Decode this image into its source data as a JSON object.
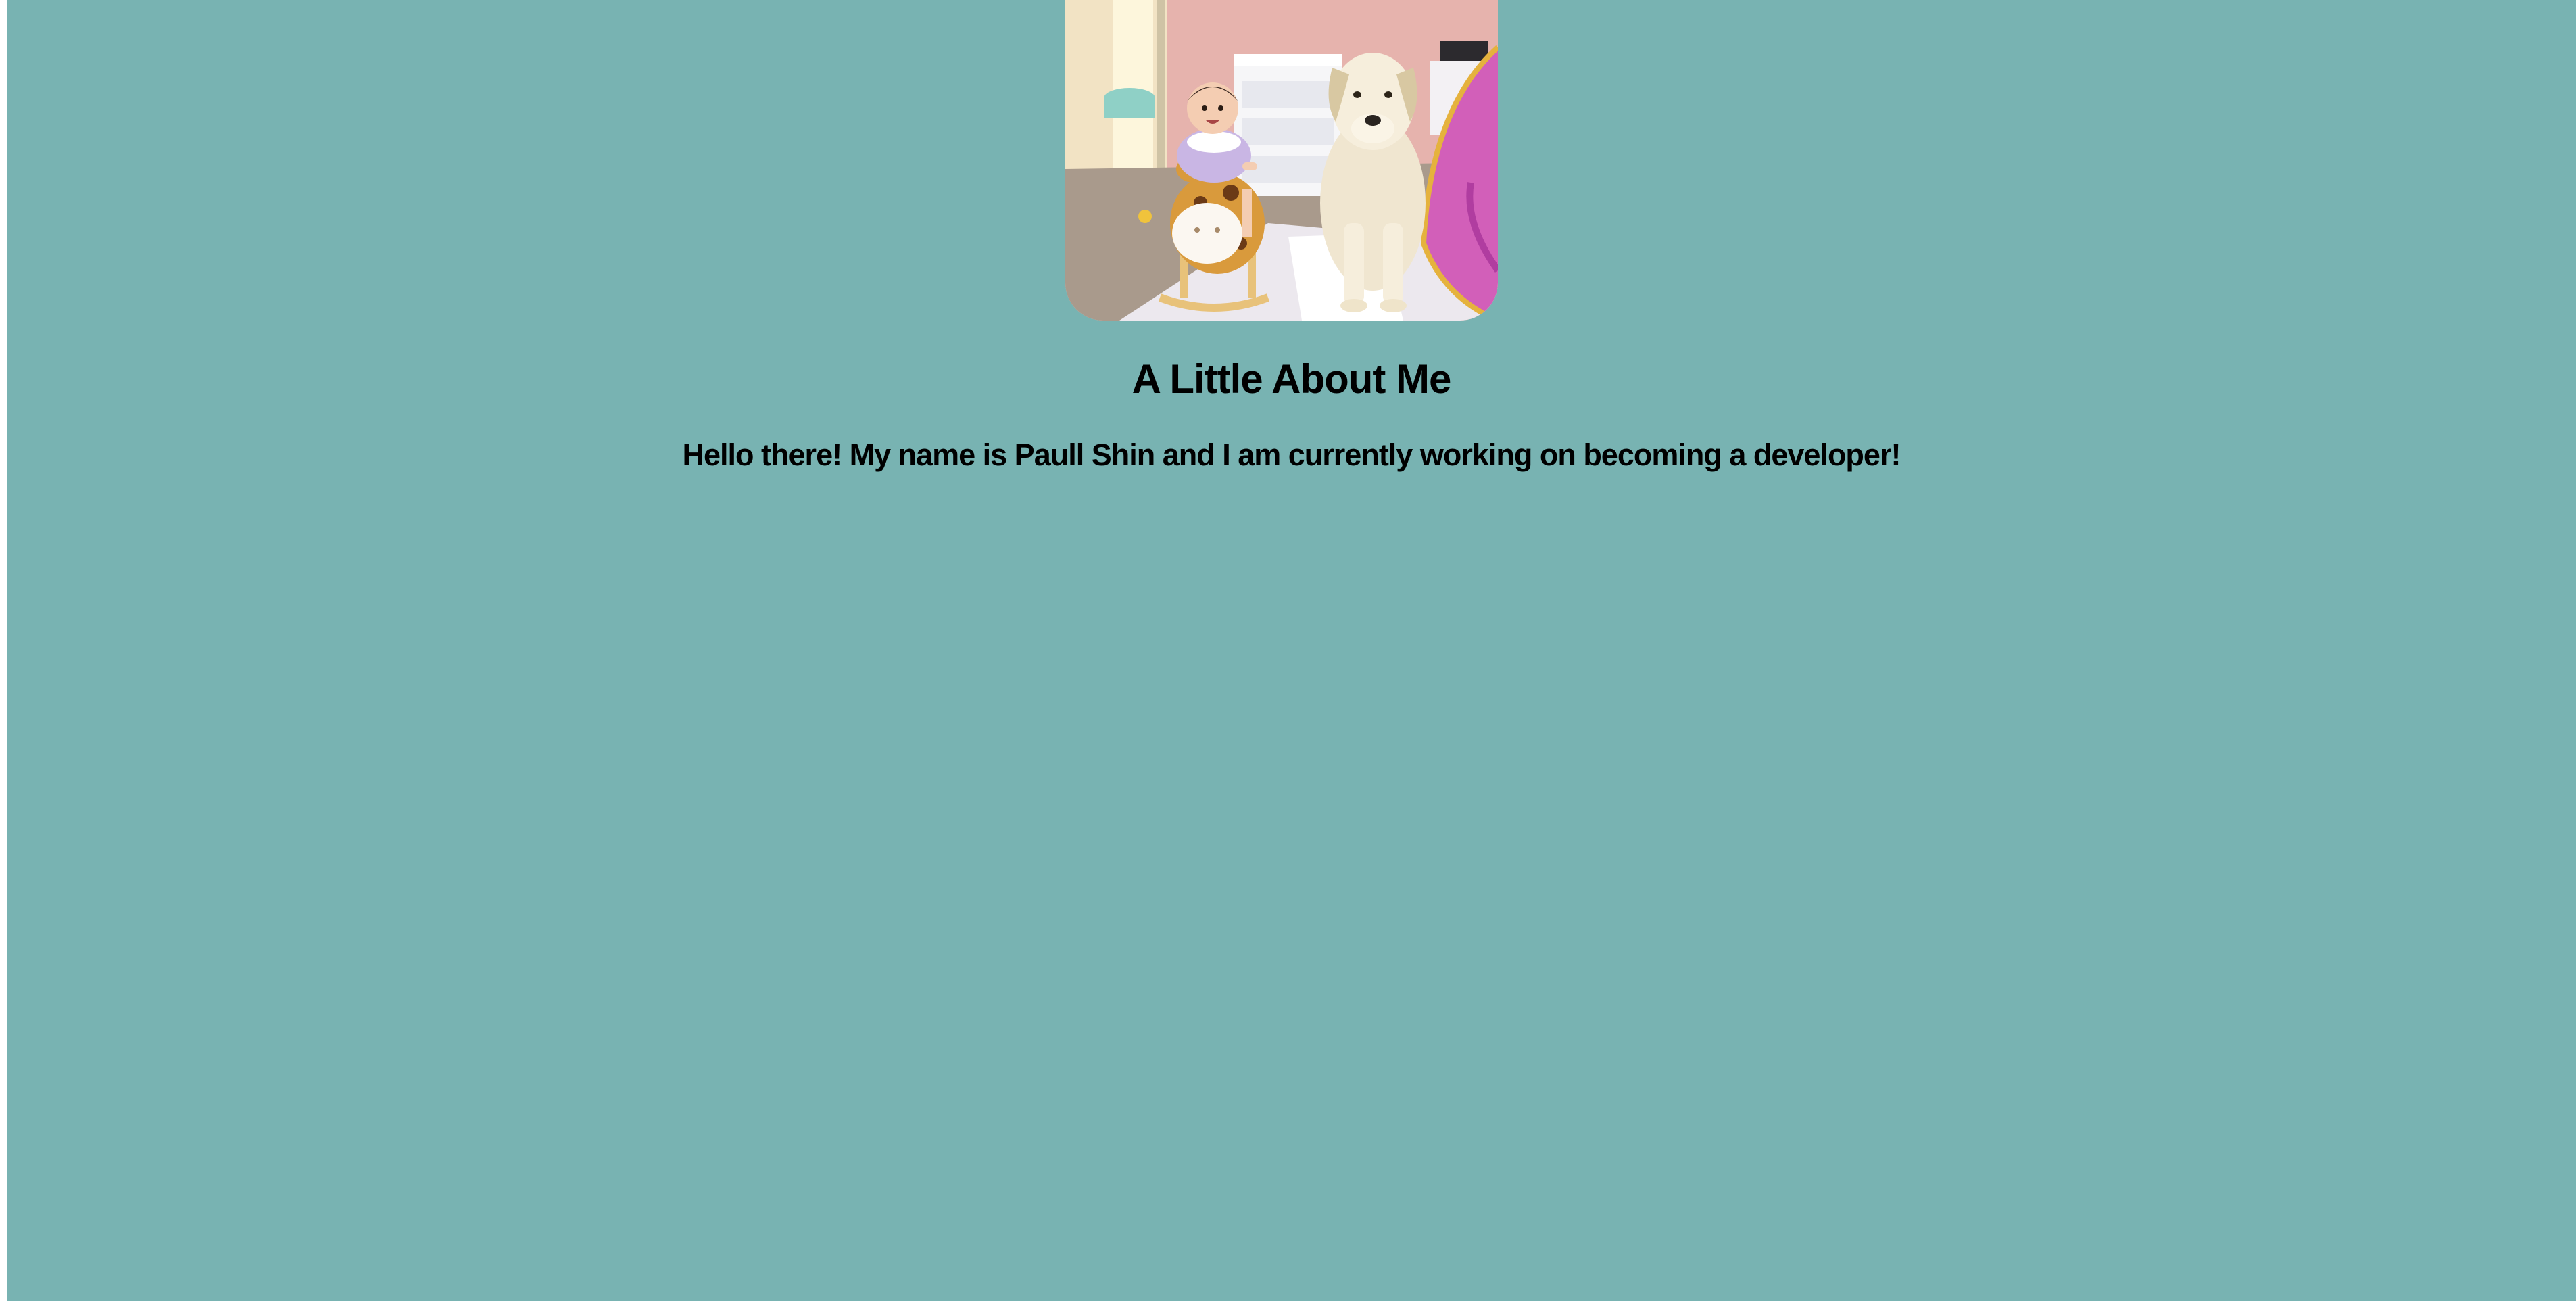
{
  "page": {
    "background_color": "#78b3b2",
    "text_color": "#000000"
  },
  "profile_photo": {
    "alt": "Paull Shin",
    "subjects": [
      "baby",
      "giraffe-rocking-toy",
      "dog",
      "pink-play-tent"
    ]
  },
  "about": {
    "title": "A Little About Me",
    "intro": "Hello there! My name is Paull Shin and I am currently working on becoming a developer!"
  }
}
